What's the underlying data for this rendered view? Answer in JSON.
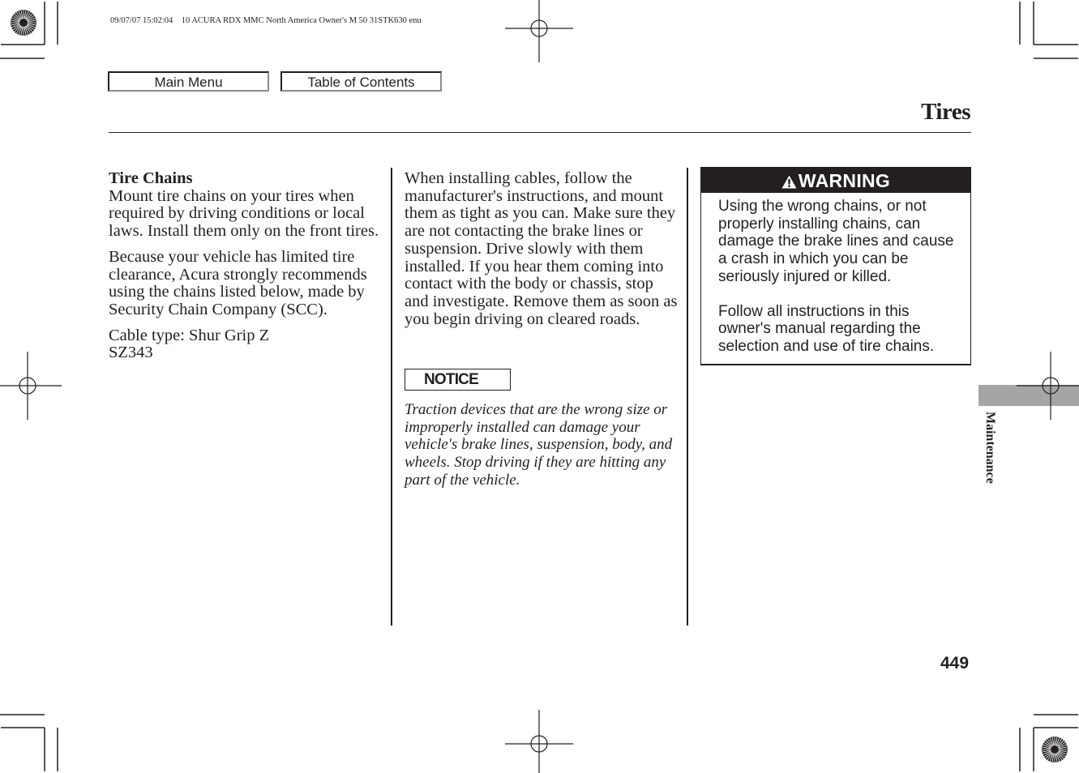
{
  "print_header": "09/07/07 15:02:04    10 ACURA RDX MMC North America Owner's M 50 31STK630 enu",
  "nav": {
    "main_menu_label": "Main Menu",
    "toc_label": "Table of Contents"
  },
  "page": {
    "title": "Tires",
    "section_tab": "Maintenance",
    "page_number": "449"
  },
  "column1": {
    "heading": "Tire Chains",
    "paragraphs": [
      "Mount tire chains on your tires when required by driving conditions or local laws. Install them only on the front tires.",
      "Because your vehicle has limited tire clearance, Acura strongly recommends using the chains listed below, made by Security Chain Company (SCC)."
    ],
    "cable_type_line1": "Cable type: Shur Grip Z",
    "cable_type_line2": "SZ343"
  },
  "column2": {
    "paragraph": "When installing cables, follow the manufacturer's instructions, and mount them as tight as you can. Make sure they are not contacting the brake lines or suspension. Drive slowly with them installed. If you hear them coming into contact with the body or chassis, stop and investigate. Remove them as soon as you begin driving on cleared roads.",
    "notice_label": "NOTICE",
    "notice_text": "Traction devices that are the wrong size or improperly installed can damage your vehicle's brake lines, suspension, body, and wheels. Stop driving if they are hitting any part of the vehicle."
  },
  "warning": {
    "label": "WARNING",
    "icon": "warning-triangle-icon",
    "paragraphs": [
      "Using the wrong chains, or not properly installing chains, can damage the brake lines and cause a crash in which you can be seriously injured or killed.",
      "Follow all instructions in this owner's manual regarding the selection and use of tire chains."
    ]
  },
  "colors": {
    "text": "#231f20",
    "tab_gray": "#a5a5a5"
  }
}
